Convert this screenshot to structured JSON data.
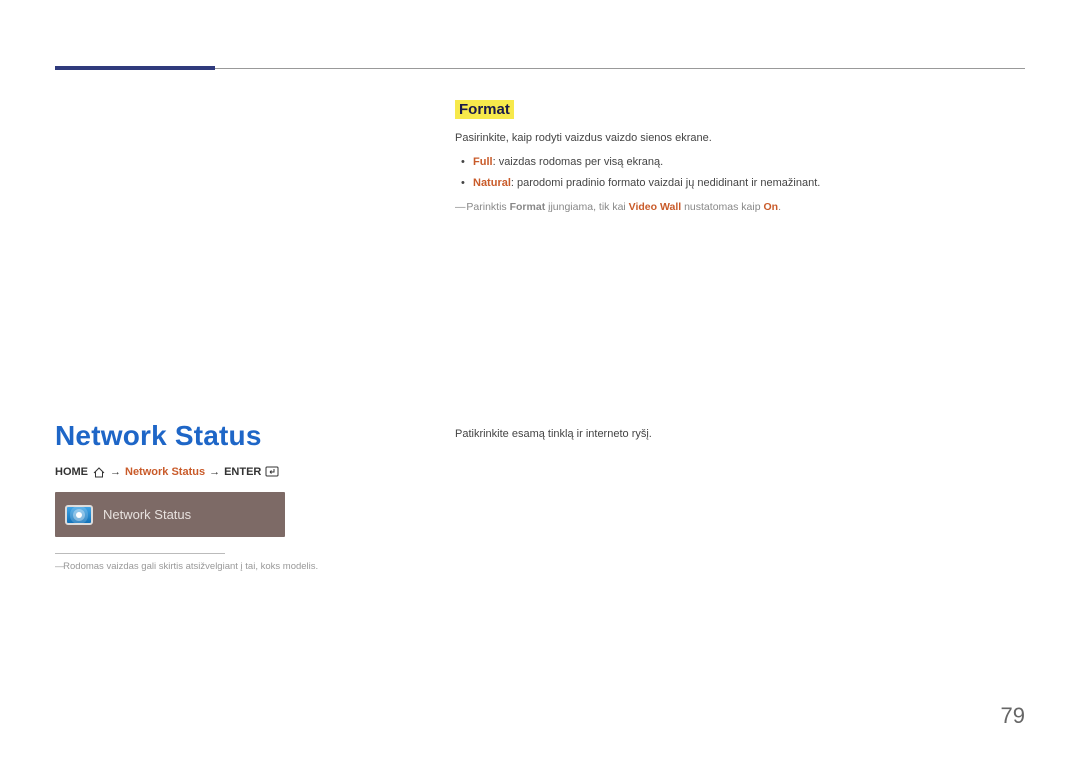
{
  "format_section": {
    "heading": "Format",
    "intro": "Pasirinkite, kaip rodyti vaizdus vaizdo sienos ekrane.",
    "bullets": [
      {
        "term": "Full",
        "sep": ": ",
        "desc": "vaizdas rodomas per visą ekraną."
      },
      {
        "term": "Natural",
        "sep": ": ",
        "desc": "parodomi pradinio formato vaizdai jų nedidinant ir nemažinant."
      }
    ],
    "note": {
      "pre": "Parinktis ",
      "t1": "Format",
      "mid": " įjungiama, tik kai ",
      "t2": "Video Wall",
      "mid2": " nustatomas kaip ",
      "t3": "On",
      "end": "."
    }
  },
  "network_section": {
    "heading": "Network Status",
    "breadcrumb": {
      "home": "HOME",
      "arrow": "→",
      "mid": "Network Status",
      "enter": "ENTER"
    },
    "tile_label": "Network Status",
    "footnote": "Rodomas vaizdas gali skirtis atsižvelgiant į tai, koks modelis.",
    "description": "Patikrinkite esamą tinklą ir interneto ryšį."
  },
  "page_number": "79"
}
